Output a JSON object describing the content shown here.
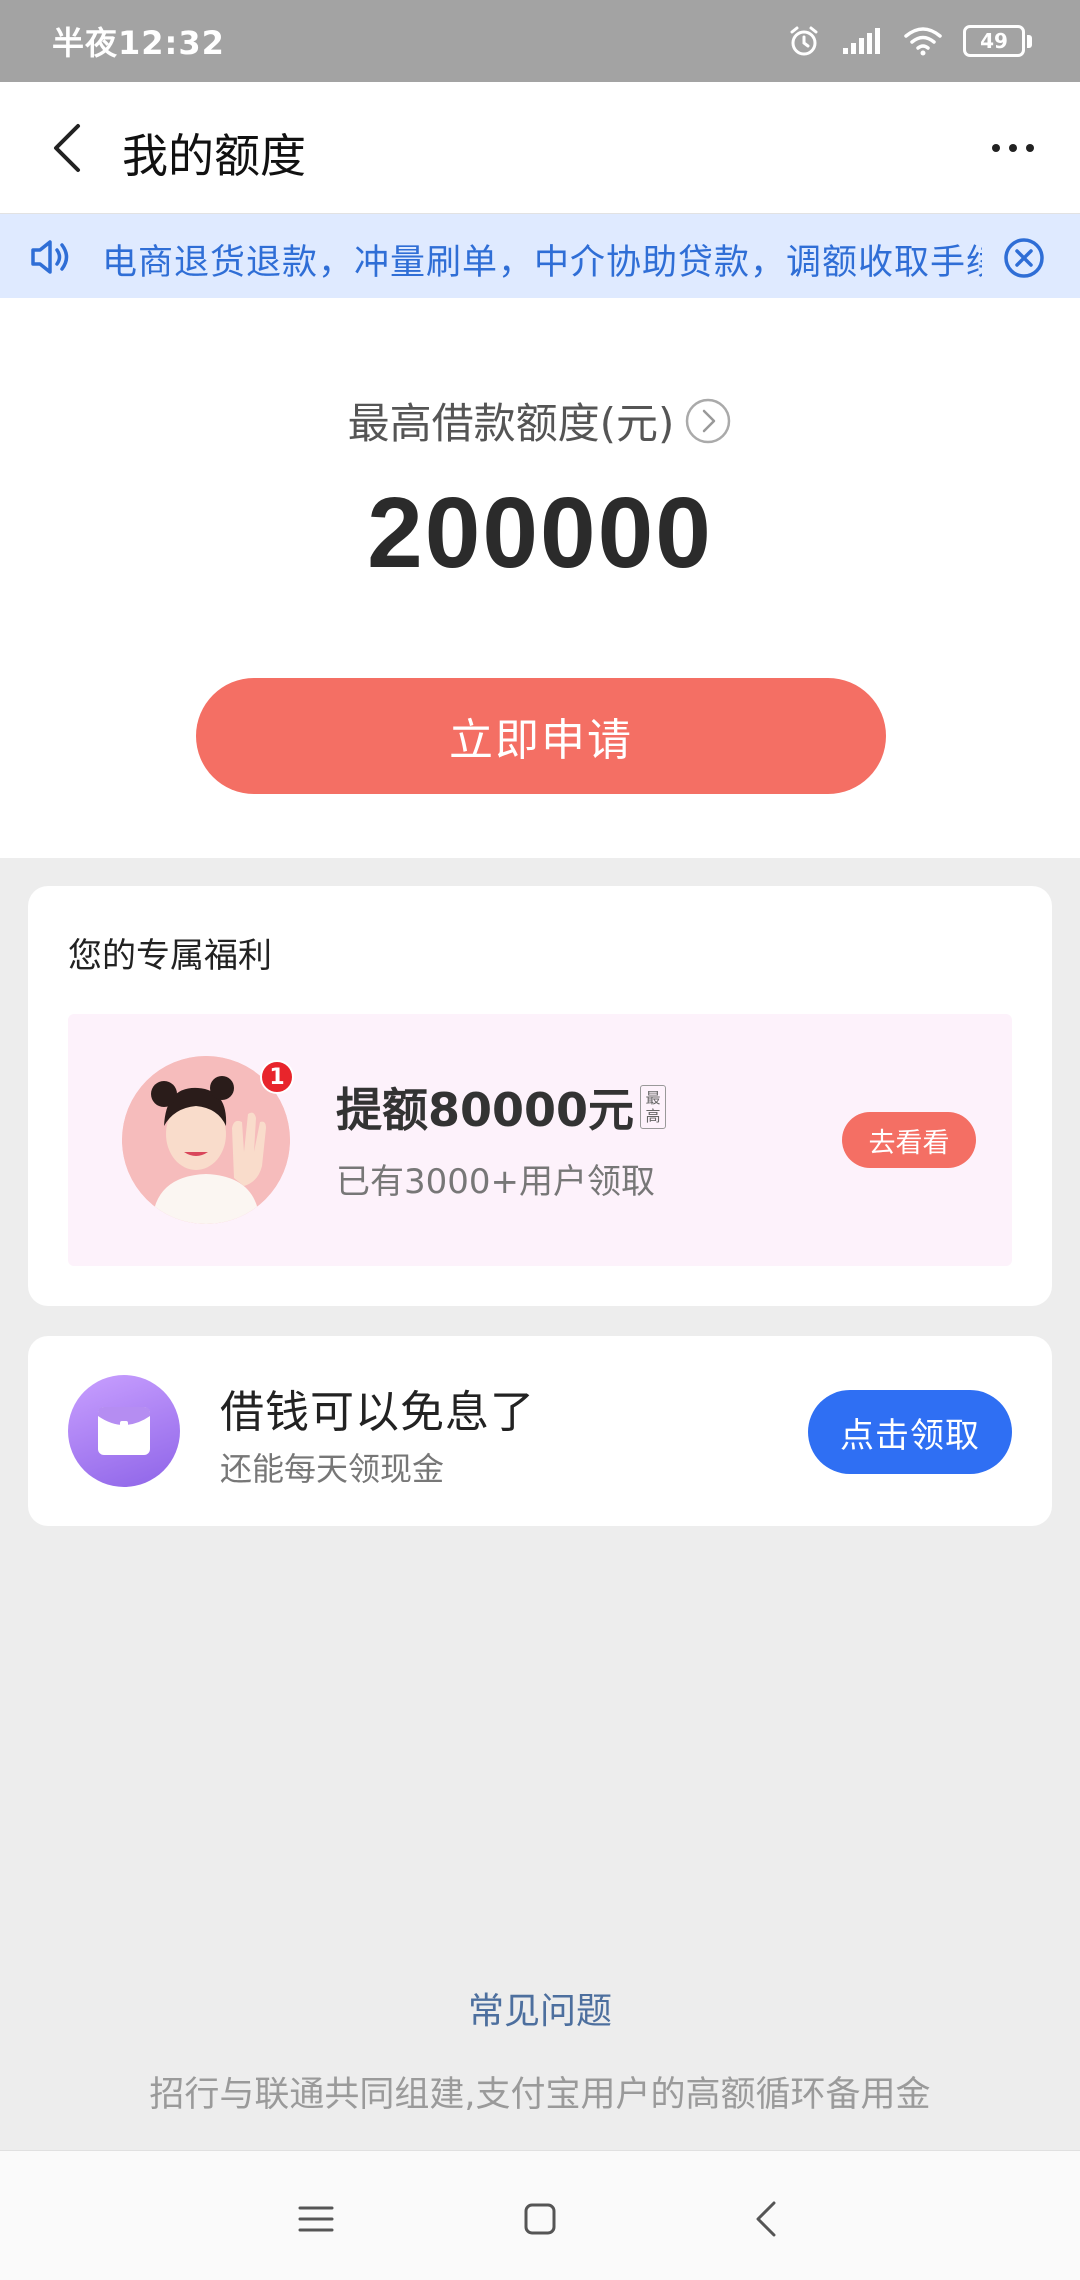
{
  "status_bar": {
    "time": "半夜12:32",
    "battery": "49",
    "icons": [
      "alarm-icon",
      "signal-icon",
      "wifi-icon",
      "battery-icon"
    ]
  },
  "nav": {
    "title": "我的额度",
    "back_icon": "chevron-left-icon",
    "more_icon": "more-dots-icon"
  },
  "notice": {
    "text": "电商退货退款，冲量刷单，中介协助贷款，调额收取手续费",
    "icon": "speaker-icon",
    "close_icon": "close-circle-icon"
  },
  "credit": {
    "label": "最高借款额度(元)",
    "amount": "200000",
    "apply_label": "立即申请"
  },
  "benefits": {
    "title": "您的专属福利",
    "promo": {
      "title": "提额80000元",
      "max_tag_line1": "最",
      "max_tag_line2": "高",
      "subtitle": "已有3000+用户领取",
      "badge": "1",
      "button_label": "去看看"
    }
  },
  "interest": {
    "title": "借钱可以免息了",
    "subtitle": "还能每天领现金",
    "button_label": "点击领取"
  },
  "footer": {
    "faq": "常见问题",
    "description": "招行与联通共同组建,支付宝用户的高额循环备用金"
  },
  "colors": {
    "primary_red": "#f46f64",
    "primary_blue": "#2f6ff3",
    "notice_bg": "#dfeaff",
    "notice_text": "#2f6ed6"
  }
}
